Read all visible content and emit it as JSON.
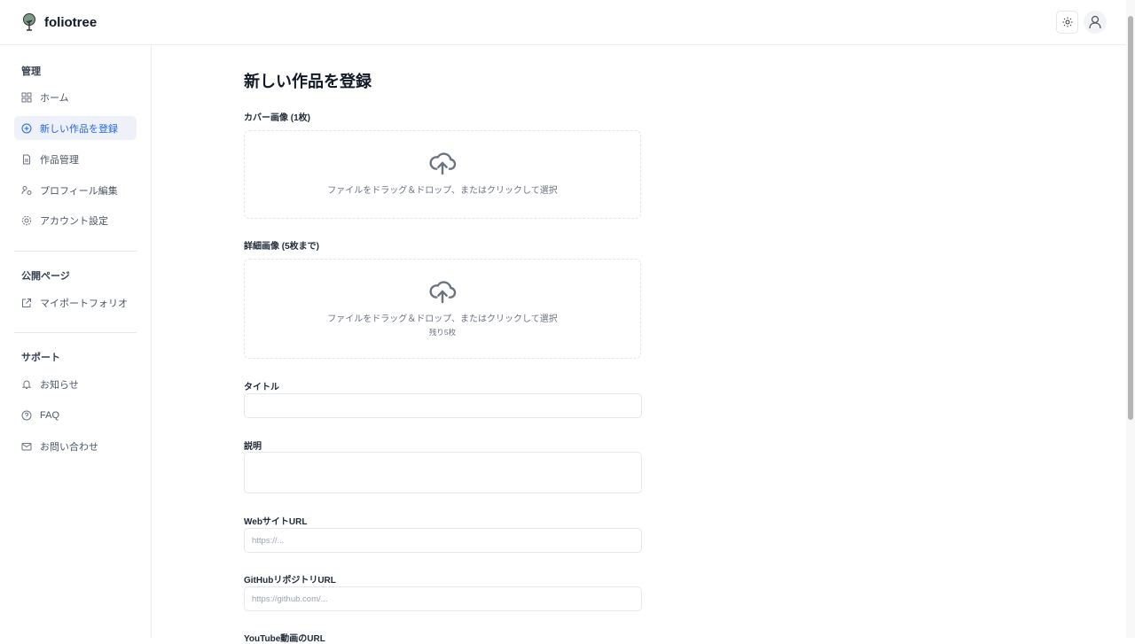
{
  "header": {
    "brand": "foliotree"
  },
  "sidebar": {
    "sections": [
      {
        "label": "管理",
        "items": [
          {
            "label": "ホーム",
            "icon": "grid-icon"
          },
          {
            "label": "新しい作品を登録",
            "icon": "plus-circle-icon",
            "active": true
          },
          {
            "label": "作品管理",
            "icon": "file-icon"
          },
          {
            "label": "プロフィール編集",
            "icon": "user-edit-icon"
          },
          {
            "label": "アカウント設定",
            "icon": "gear-icon"
          }
        ]
      },
      {
        "label": "公開ページ",
        "items": [
          {
            "label": "マイポートフォリオ",
            "icon": "external-link-icon"
          }
        ]
      },
      {
        "label": "サポート",
        "items": [
          {
            "label": "お知らせ",
            "icon": "bell-icon"
          },
          {
            "label": "FAQ",
            "icon": "help-circle-icon"
          },
          {
            "label": "お問い合わせ",
            "icon": "mail-icon"
          }
        ]
      }
    ]
  },
  "form": {
    "title": "新しい作品を登録",
    "cover_label": "カバー画像 (1枚)",
    "cover_hint": "ファイルをドラッグ＆ドロップ、またはクリックして選択",
    "detail_label": "詳細画像 (5枚まで)",
    "detail_hint": "ファイルをドラッグ＆ドロップ、またはクリックして選択",
    "detail_remaining": "残り5枚",
    "title_label": "タイトル",
    "title_value": "",
    "desc_label": "説明",
    "desc_value": "",
    "web_label": "WebサイトURL",
    "web_placeholder": "https://...",
    "github_label": "GitHubリポジトリURL",
    "github_placeholder": "https://github.com/...",
    "youtube_label": "YouTube動画のURL"
  }
}
